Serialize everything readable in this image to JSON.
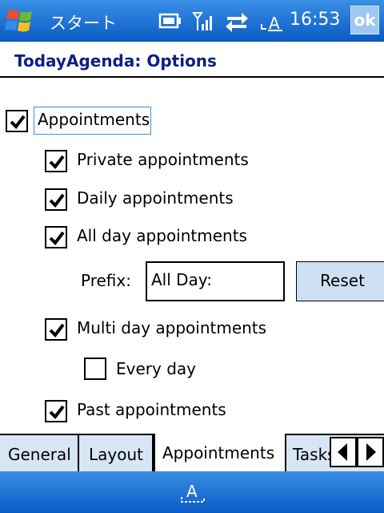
{
  "topbar": {
    "start_label": "スタート",
    "time": "16:53",
    "ok_label": "ok"
  },
  "window": {
    "title": "TodayAgenda: Options"
  },
  "options": {
    "appointments": {
      "label": "Appointments",
      "checked": true
    },
    "private": {
      "label": "Private appointments",
      "checked": true
    },
    "daily": {
      "label": "Daily appointments",
      "checked": true
    },
    "allday": {
      "label": "All day appointments",
      "checked": true
    },
    "prefix_label": "Prefix:",
    "prefix_value": "All Day:",
    "reset_label": "Reset",
    "multiday": {
      "label": "Multi day appointments",
      "checked": true
    },
    "everyday": {
      "label": "Every day",
      "checked": false
    },
    "past": {
      "label": "Past appointments",
      "checked": true
    }
  },
  "tabs": [
    {
      "label": "General"
    },
    {
      "label": "Layout"
    },
    {
      "label": "Appointments",
      "active": true
    },
    {
      "label": "Tasks"
    }
  ],
  "icons": [
    "windows-flag-icon",
    "battery-icon",
    "signal-icon",
    "sync-icon",
    "input-method-icon",
    "keyboard-icon"
  ],
  "colors": {
    "bar_blue": "#0a5bc4",
    "title_blue": "#0c1f85",
    "tab_bg": "#d7e5f4",
    "button_bg": "#cde0f2"
  }
}
